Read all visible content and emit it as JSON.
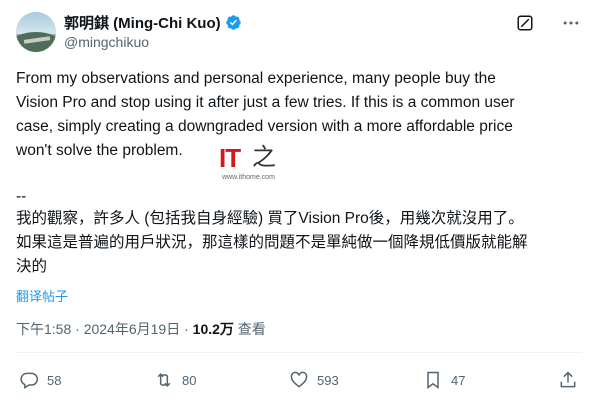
{
  "author": {
    "display_name": "郭明錤 (Ming-Chi Kuo)",
    "handle": "@mingchikuo"
  },
  "tweet": {
    "text_en": "From my observations and personal experience, many people buy the\nVision Pro and stop using it after just a few tries. If this is a common user\ncase, simply creating a downgraded version with a more affordable price\nwon't solve the problem.",
    "separator": "--",
    "text_zh": "我的觀察，許多人 (包括我自身經驗) 買了Vision Pro後，用幾次就沒用了。\n如果這是普遍的用戶狀況，那這樣的問題不是單純做一個降規低價版就能解\n決的",
    "translate_label": "翻译帖子"
  },
  "watermark": {
    "logo_text": "IT",
    "logo_char": "之",
    "url": "www.ithome.com"
  },
  "meta": {
    "time": "下午1:58",
    "sep1": " · ",
    "date": "2024年6月19日",
    "sep2": " · ",
    "views": "10.2万",
    "views_label": " 查看"
  },
  "actions": {
    "replies": "58",
    "reposts": "80",
    "likes": "593",
    "bookmarks": "47"
  },
  "colors": {
    "link": "#1d9bf0",
    "verified": "#1d9bf0",
    "secondary_text": "#536471"
  },
  "icons": [
    "verified-badge-icon",
    "grok-icon",
    "more-icon",
    "reply-icon",
    "repost-icon",
    "like-icon",
    "bookmark-icon",
    "share-icon"
  ]
}
